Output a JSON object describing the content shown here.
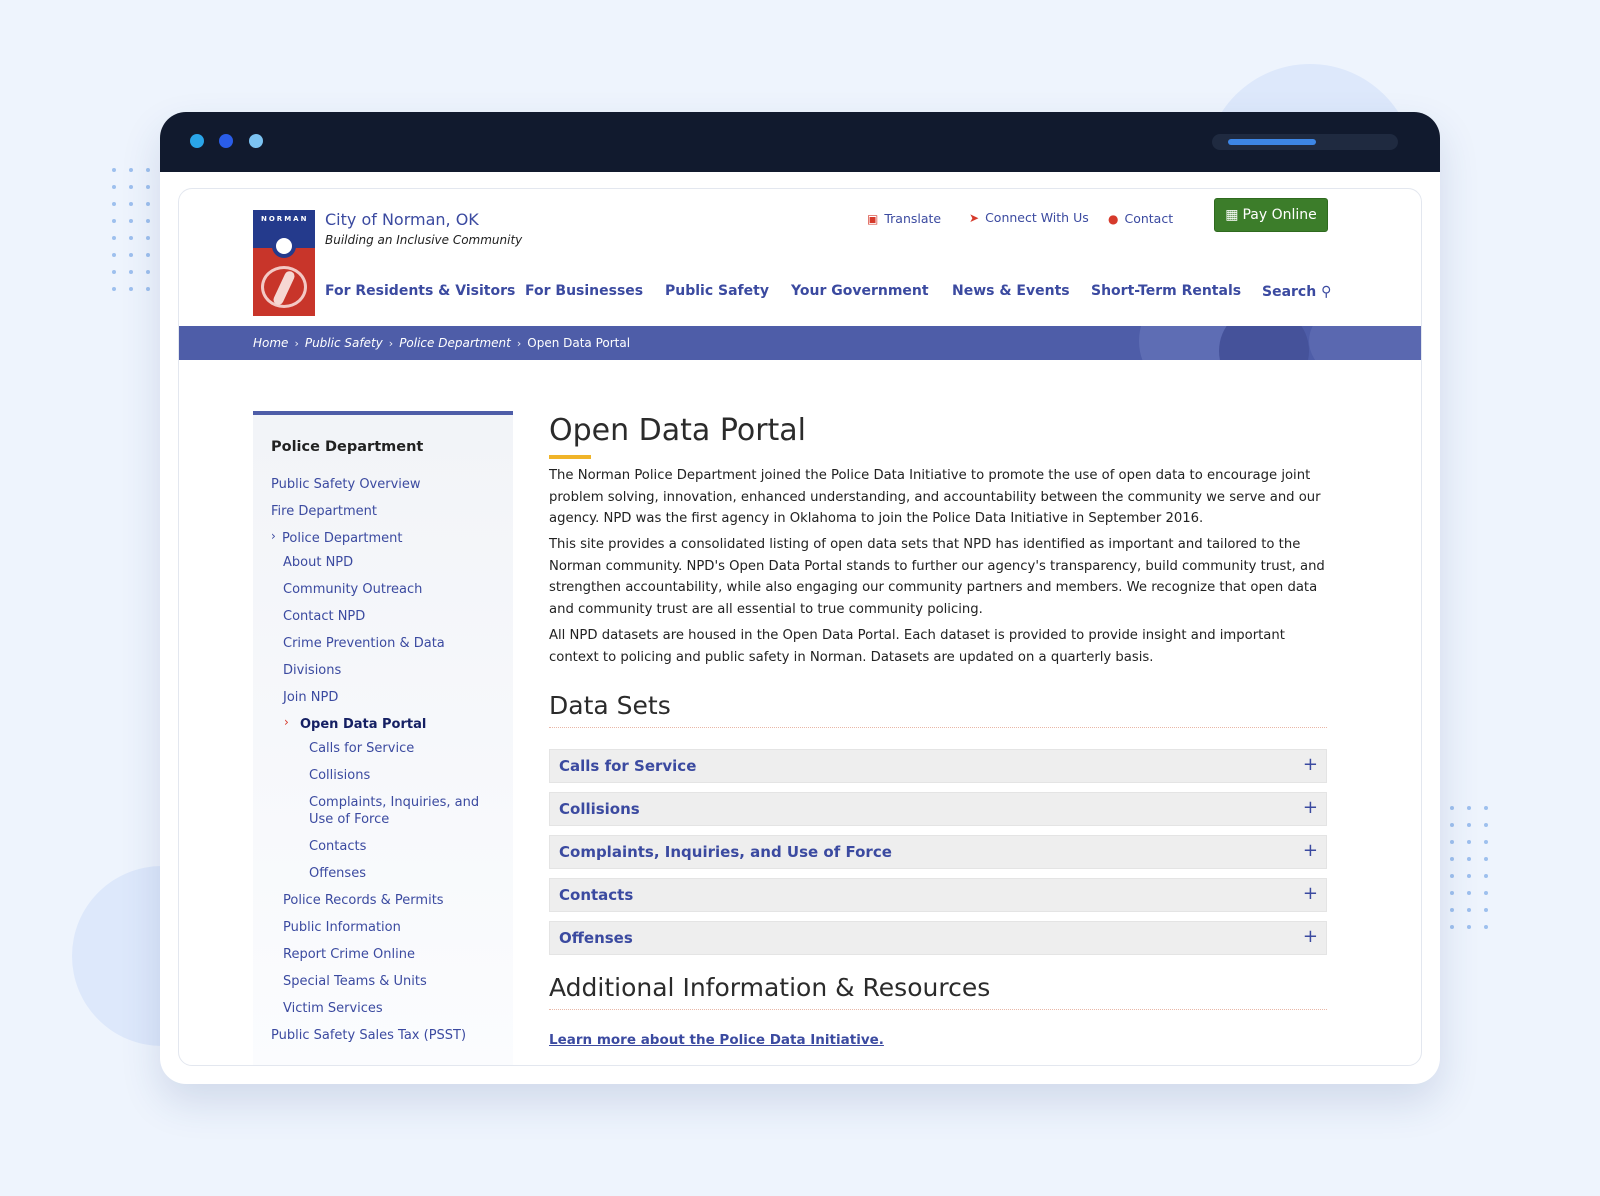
{
  "window": {
    "dot_colors": [
      "#2aa5e8",
      "#2a5de8",
      "#7cc3f2"
    ]
  },
  "header": {
    "site_name": "City of Norman, OK",
    "tagline": "Building an Inclusive Community",
    "logo_text": "NORMAN",
    "utility": [
      {
        "label": "Translate",
        "icon": "translate-icon"
      },
      {
        "label": "Connect With Us",
        "icon": "share-icon"
      },
      {
        "label": "Contact",
        "icon": "chat-icon"
      }
    ],
    "pay_label": "Pay Online"
  },
  "nav": {
    "items": [
      "For Residents & Visitors",
      "For Businesses",
      "Public Safety",
      "Your Government",
      "News & Events",
      "Short-Term Rentals"
    ],
    "search_label": "Search"
  },
  "breadcrumb": [
    "Home",
    "Public Safety",
    "Police Department",
    "Open Data Portal"
  ],
  "sidebar": {
    "title": "Police Department",
    "items": [
      "Public Safety Overview",
      "Fire Department",
      "Police Department",
      "About NPD",
      "Community Outreach",
      "Contact NPD",
      "Crime Prevention & Data",
      "Divisions",
      "Join NPD",
      "Open Data Portal",
      "Calls for Service",
      "Collisions",
      "Complaints, Inquiries, and",
      "Use of Force",
      "Contacts",
      "Offenses",
      "Police Records & Permits",
      "Public Information",
      "Report Crime Online",
      "Special Teams & Units",
      "Victim Services",
      "Public Safety Sales Tax (PSST)"
    ]
  },
  "main": {
    "title": "Open Data Portal",
    "paragraphs": [
      "The Norman Police Department joined the Police Data Initiative to promote the use of open data to encourage joint problem solving, innovation, enhanced understanding, and accountability between the community we serve and our agency. NPD was the first agency in Oklahoma to join the Police Data Initiative in September 2016.",
      "This site provides a consolidated listing of open data sets that NPD has identified as important and tailored to the Norman community. NPD's Open Data Portal stands to further our agency's transparency, build community trust, and strengthen accountability, while also engaging our community partners and members. We recognize that open data and community trust are all essential to true community policing.",
      "All NPD datasets are housed in the Open Data Portal. Each dataset is provided to provide insight and important context to policing and public safety in Norman. Datasets are updated on a quarterly basis."
    ],
    "datasets_heading": "Data Sets",
    "datasets": [
      "Calls for Service",
      "Collisions",
      "Complaints, Inquiries, and Use of Force",
      "Contacts",
      "Offenses"
    ],
    "expand_symbol": "+",
    "resources_heading": "Additional Information & Resources",
    "resource_link": "Learn more about the Police Data Initiative."
  }
}
